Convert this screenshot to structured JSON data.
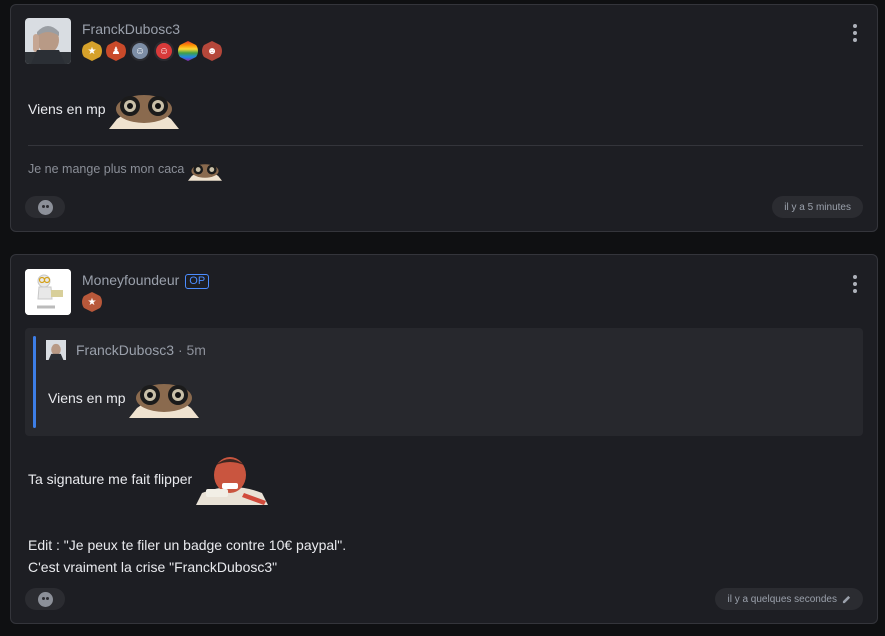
{
  "posts": [
    {
      "username": "FranckDubosc3",
      "message": "Viens en mp",
      "signature": "Je ne mange plus mon caca",
      "timestamp": "il y a 5 minutes",
      "badge_count": 6
    },
    {
      "username": "Moneyfoundeur",
      "op_label": "OP",
      "quote": {
        "username": "FranckDubosc3",
        "separator": "·",
        "age": "5m",
        "message": "Viens en mp"
      },
      "line1": "Ta signature me fait flipper",
      "line2": "Edit : \"Je peux te filer un badge contre 10€ paypal\".",
      "line3": "C'est vraiment la crise \"FranckDubosc3\"",
      "timestamp": "il y a quelques secondes",
      "edited_icon": "pencil-icon"
    }
  ],
  "colors": {
    "background": "#0f1012",
    "card": "#1d1e23",
    "quote_accent": "#3d7ee6",
    "op_tag": "#4c8dff"
  }
}
